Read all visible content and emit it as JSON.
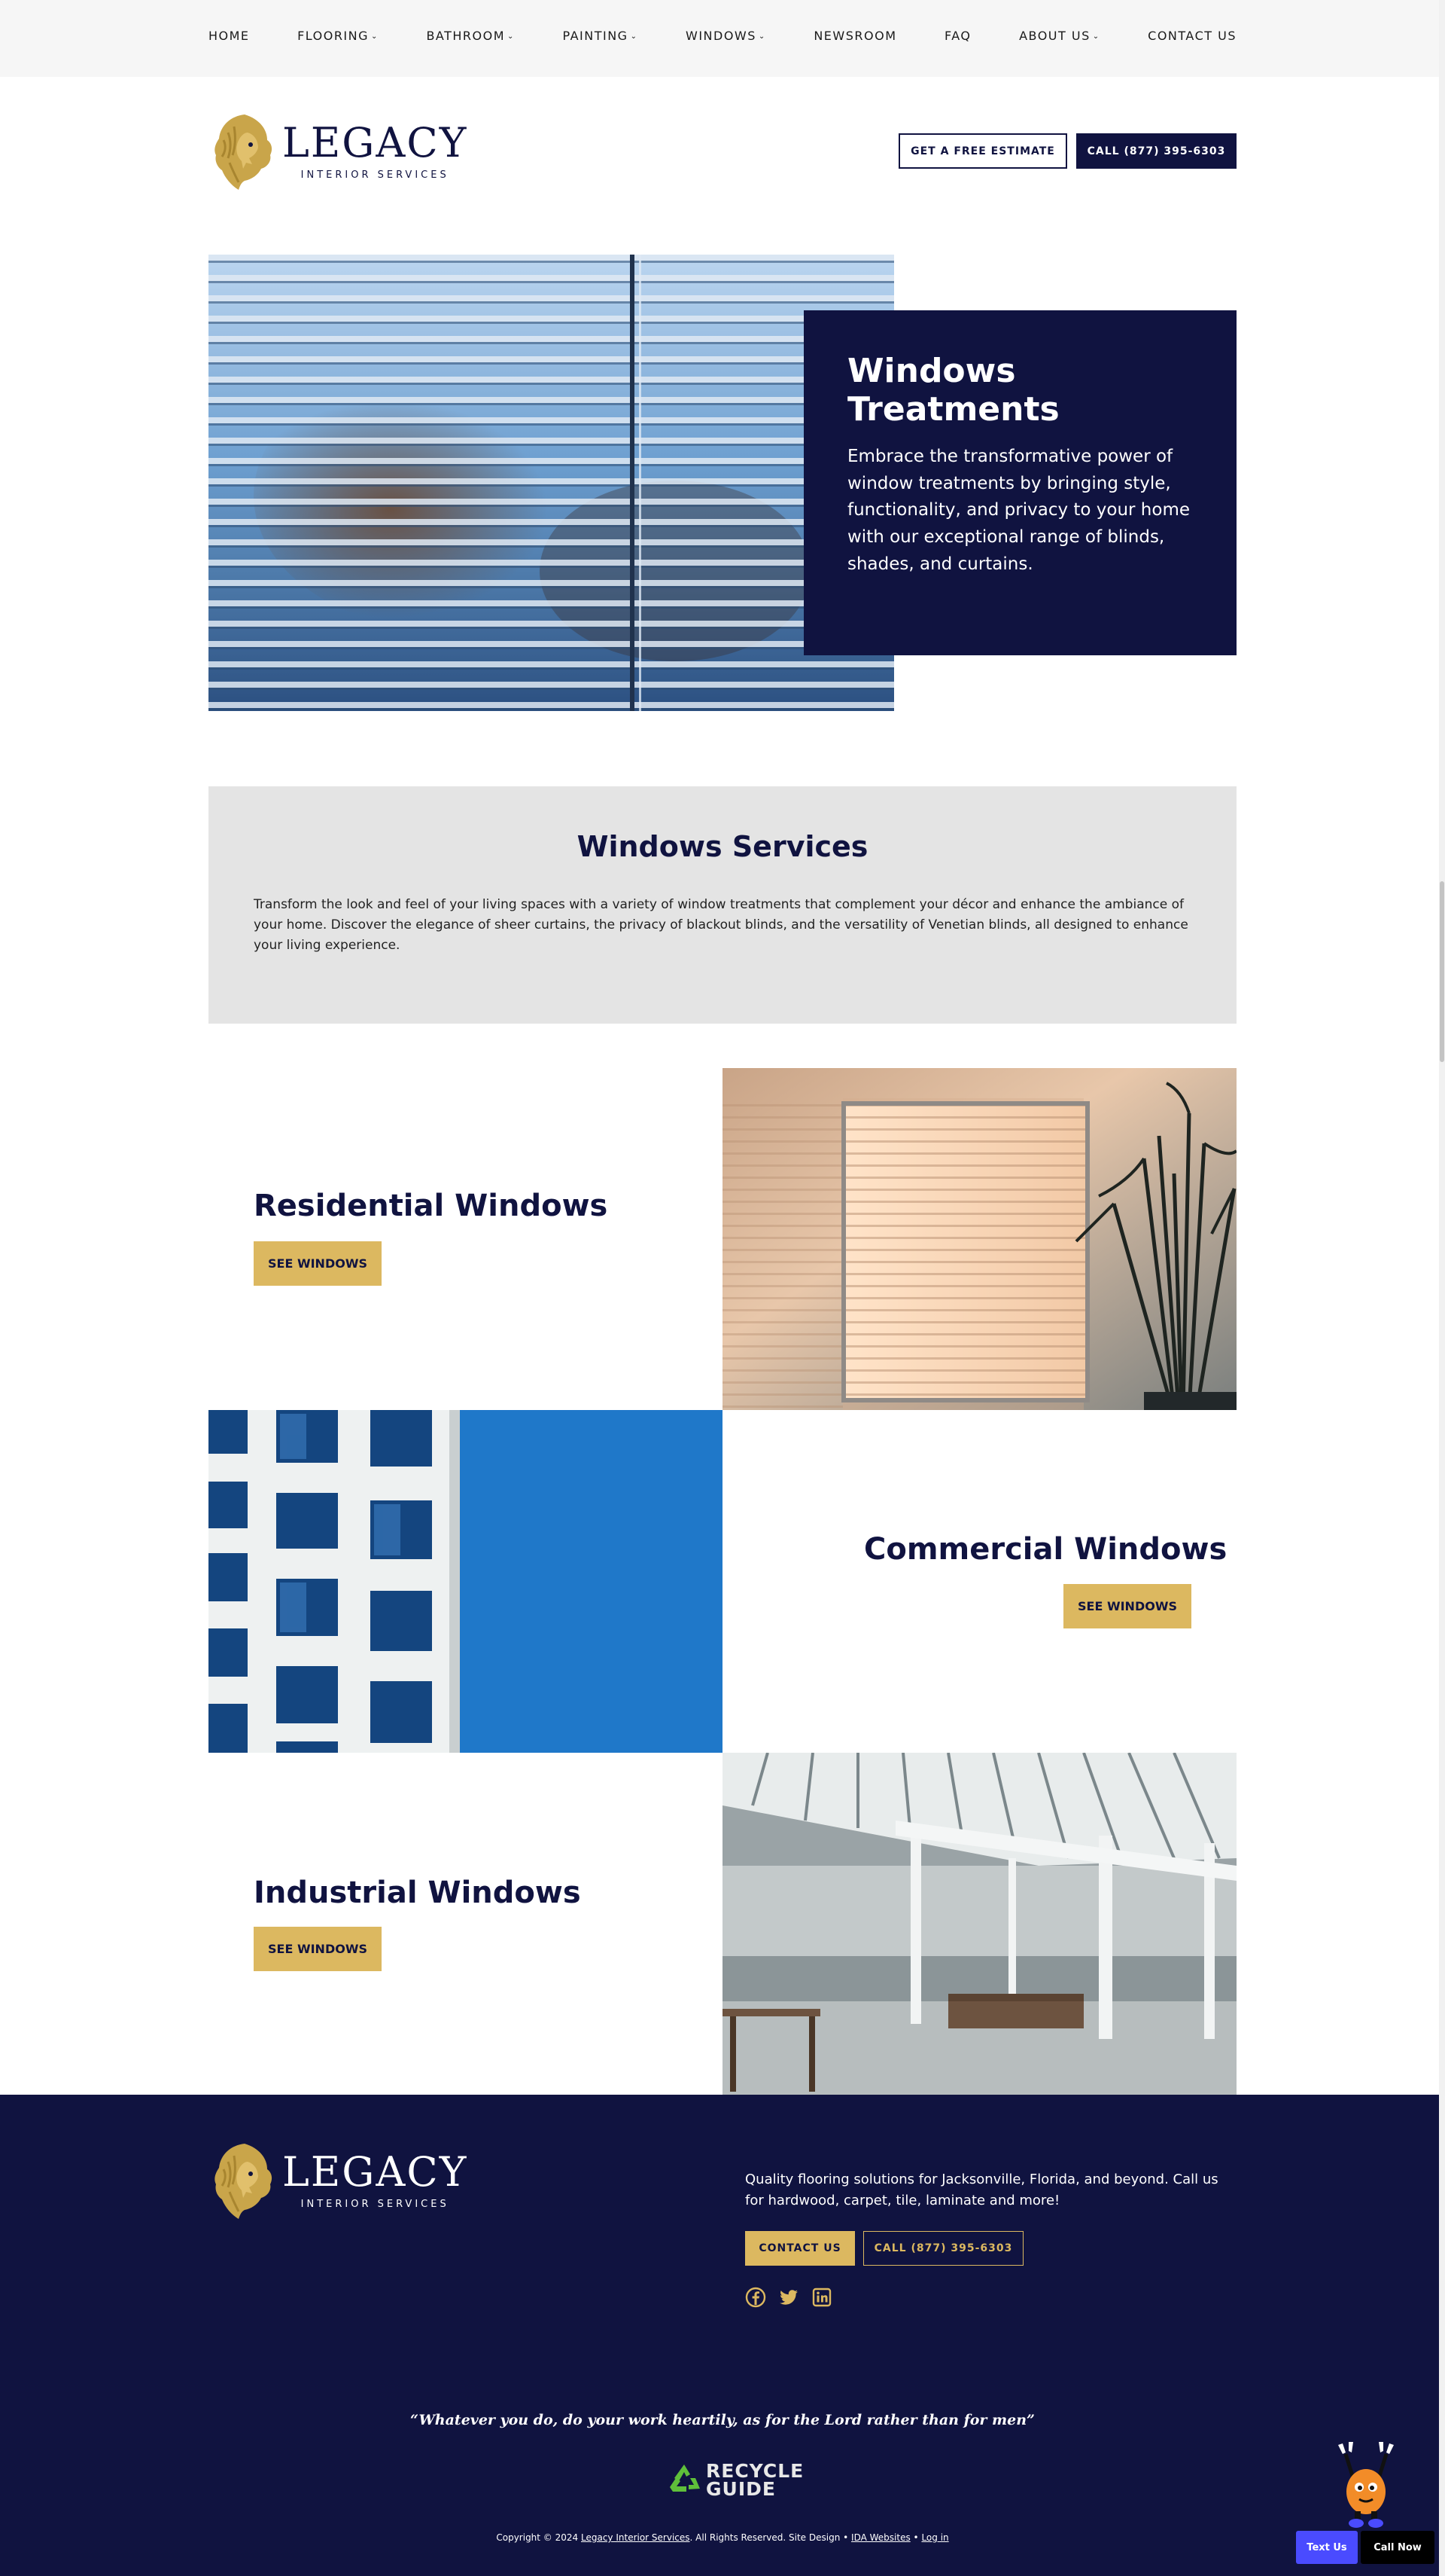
{
  "nav": {
    "items": [
      {
        "label": "HOME",
        "dropdown": false
      },
      {
        "label": "FLOORING",
        "dropdown": true
      },
      {
        "label": "BATHROOM",
        "dropdown": true
      },
      {
        "label": "PAINTING",
        "dropdown": true
      },
      {
        "label": "WINDOWS",
        "dropdown": true
      },
      {
        "label": "NEWSROOM",
        "dropdown": false
      },
      {
        "label": "FAQ",
        "dropdown": false
      },
      {
        "label": "ABOUT US",
        "dropdown": true
      },
      {
        "label": "CONTACT US",
        "dropdown": false
      }
    ],
    "chevron": "⌄"
  },
  "logo": {
    "brand": "LEGACY",
    "subtitle": "INTERIOR SERVICES",
    "icon": "lion-head-icon",
    "gold": "#c9a54a"
  },
  "header": {
    "estimate_label": "GET A FREE ESTIMATE",
    "call_label": "CALL (877) 395-6303"
  },
  "hero": {
    "title": "Windows Treatments",
    "body": "Embrace the transformative power of window treatments by bringing style, functionality, and privacy to your home with our exceptional range of blinds, shades, and curtains."
  },
  "services": {
    "title": "Windows Services",
    "body": "Transform the look and feel of your living spaces with a variety of window treatments that complement your décor and enhance the ambiance of your home. Discover the elegance of sheer curtains, the privacy of blackout blinds, and the versatility of Venetian blinds, all designed to enhance your living experience."
  },
  "rows": [
    {
      "title": "Residential Windows",
      "button": "SEE WINDOWS"
    },
    {
      "title": "Commercial Windows",
      "button": "SEE WINDOWS"
    },
    {
      "title": "Industrial Windows",
      "button": "SEE WINDOWS"
    }
  ],
  "footer": {
    "blurb": "Quality flooring solutions for Jacksonville, Florida, and beyond. Call us for hardwood, carpet, tile, laminate and more!",
    "contact_label": "CONTACT US",
    "call_label": "CALL (877) 395-6303",
    "social": [
      "facebook-icon",
      "twitter-icon",
      "linkedin-icon"
    ],
    "quote": "“Whatever you do, do your work heartily, as for the Lord rather than for men”",
    "recycle_line1": "RECYCLE",
    "recycle_line2": "GUIDE",
    "copyright_prefix": "Copyright © 2024",
    "copyright_company": "Legacy Interior Services",
    "copyright_mid": ". All Rights Reserved. Site Design •",
    "copyright_designer": "IDA Websites",
    "copyright_sep": "•",
    "copyright_login": "Log in"
  },
  "widgets": {
    "text_us": "Text Us",
    "call_now": "Call Now"
  },
  "colors": {
    "navy": "#101340",
    "gold": "#dcb860",
    "grey_panel": "#e4e4e4",
    "nav_bg": "#f6f6f6"
  }
}
